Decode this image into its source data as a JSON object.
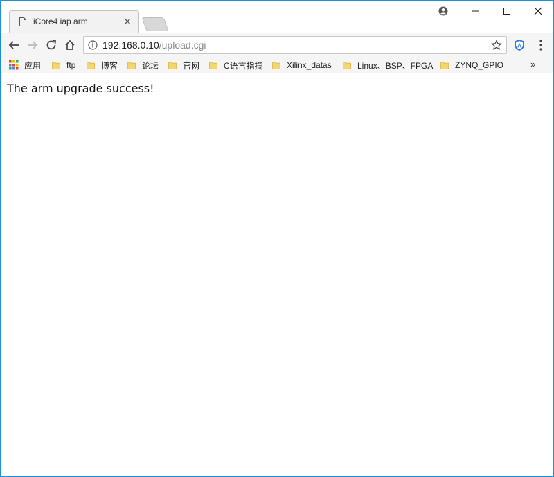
{
  "tab": {
    "title": "iCore4 iap arm",
    "close_glyph": "✕"
  },
  "window_controls": {
    "profile": "profile-icon",
    "minimize": "minimize-icon",
    "maximize": "maximize-icon",
    "close": "close-icon"
  },
  "toolbar": {
    "url_host": "192.168.0.10",
    "url_path": "/upload.cgi"
  },
  "bookmarks": {
    "apps_label": "应用",
    "items": [
      "ftp",
      "博客",
      "论坛",
      "官网",
      "C语言指摘",
      "Xilinx_datas",
      "Linux、BSP、FPGA",
      "ZYNQ_GPIO"
    ],
    "overflow": "»"
  },
  "content": {
    "message": "The arm upgrade success!"
  },
  "colors": {
    "window_border": "#1e8fd6",
    "folder": "#f5d66b",
    "extension": "#2f7ad8"
  }
}
